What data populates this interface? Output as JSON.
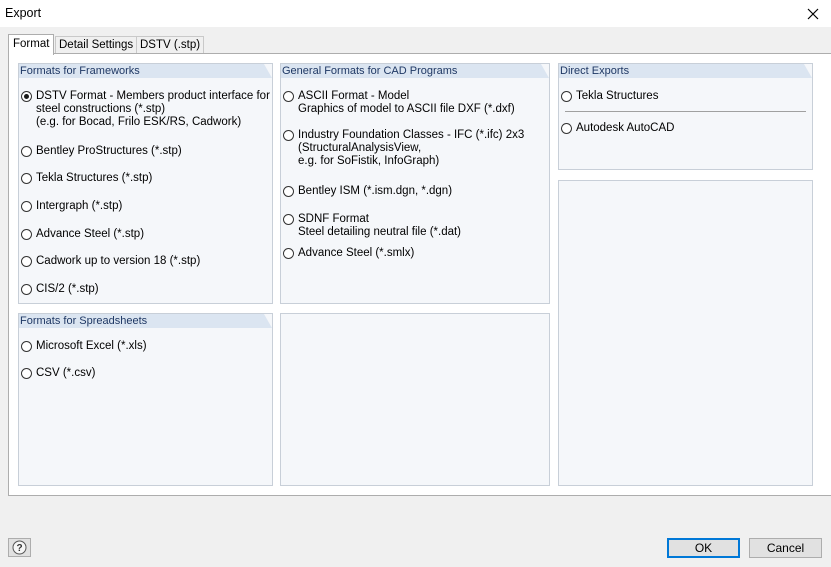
{
  "window": {
    "title": "Export",
    "close_icon": "close-icon"
  },
  "tabs": [
    {
      "label": "Format",
      "active": true
    },
    {
      "label": "Detail Settings",
      "active": false
    },
    {
      "label": "DSTV (.stp)",
      "active": false
    }
  ],
  "groups": {
    "frameworks": {
      "title": "Formats for Frameworks",
      "options": [
        {
          "line1": "DSTV Format - Members product interface for",
          "line2": "steel constructions (*.stp)",
          "line3": "(e.g. for Bocad, Frilo ESK/RS, Cadwork)",
          "checked": true
        },
        {
          "line1": "Bentley ProStructures (*.stp)",
          "checked": false
        },
        {
          "line1": "Tekla Structures (*.stp)",
          "checked": false
        },
        {
          "line1": "Intergraph (*.stp)",
          "checked": false
        },
        {
          "line1": "Advance Steel (*.stp)",
          "checked": false
        },
        {
          "line1": "Cadwork up to version 18 (*.stp)",
          "checked": false
        },
        {
          "line1": "CIS/2 (*.stp)",
          "checked": false
        }
      ]
    },
    "spreadsheets": {
      "title": "Formats for Spreadsheets",
      "options": [
        {
          "line1": "Microsoft Excel (*.xls)",
          "checked": false
        },
        {
          "line1": "CSV (*.csv)",
          "checked": false
        }
      ]
    },
    "cad": {
      "title": "General Formats for CAD Programs",
      "options": [
        {
          "line1": "ASCII Format - Model",
          "line2": "Graphics of model to ASCII file DXF (*.dxf)",
          "checked": false
        },
        {
          "line1": "Industry Foundation Classes - IFC (*.ifc) 2x3",
          "line2": "(StructuralAnalysisView,",
          "line3": "e.g. for SoFistik, InfoGraph)",
          "checked": false
        },
        {
          "line1": "Bentley ISM (*.ism.dgn, *.dgn)",
          "checked": false
        },
        {
          "line1": "SDNF Format",
          "line2": "Steel detailing neutral file (*.dat)",
          "checked": false
        },
        {
          "line1": "Advance Steel (*.smlx)",
          "checked": false
        }
      ]
    },
    "direct": {
      "title": "Direct Exports",
      "options": [
        {
          "line1": "Tekla Structures",
          "checked": false
        },
        {
          "line1": "Autodesk AutoCAD",
          "checked": false
        }
      ]
    }
  },
  "footer": {
    "help_icon": "help-icon",
    "ok_label": "OK",
    "cancel_label": "Cancel"
  },
  "colors": {
    "group_header_bg": "#dbe5f1",
    "group_header_text": "#1f3864",
    "default_button_border": "#0078d7"
  }
}
